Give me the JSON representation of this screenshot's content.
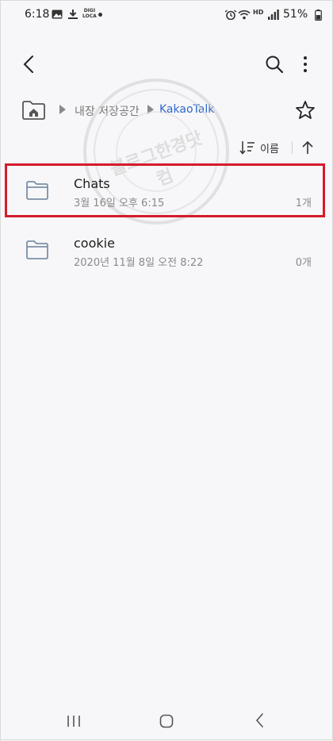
{
  "status_bar": {
    "time": "6:18",
    "digi_top": "DIGI",
    "digi_bottom": "LOCA",
    "hd_label": "HD",
    "battery": "51%"
  },
  "toolbar": {
    "back_icon": "back-arrow-icon",
    "search_icon": "search-icon",
    "more_icon": "more-vert-icon"
  },
  "breadcrumb": {
    "home_icon": "home-folder-icon",
    "internal_storage": "내장 저장공간",
    "current": "KakaoTalk",
    "favorite_icon": "star-icon"
  },
  "sort": {
    "label": "이름",
    "direction_icon": "arrow-up-icon"
  },
  "files": [
    {
      "name": "Chats",
      "date": "3월 16일 오후 6:15",
      "count": "1개",
      "highlighted": true
    },
    {
      "name": "cookie",
      "date": "2020년 11월 8일 오전 8:22",
      "count": "0개",
      "highlighted": false
    }
  ],
  "watermark": {
    "text": "블로그한경닷컴"
  },
  "colors": {
    "accent": "#2f68c9",
    "highlight": "#d41b2c",
    "folder": "#7b8fa6"
  }
}
